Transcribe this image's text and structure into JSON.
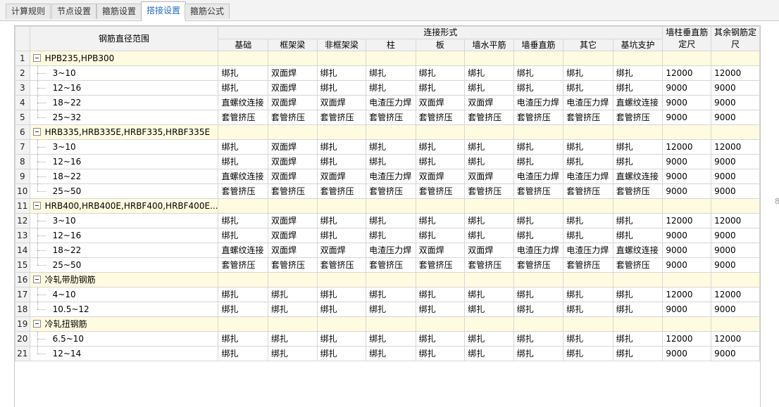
{
  "tabs": [
    {
      "label": "计算规则"
    },
    {
      "label": "节点设置"
    },
    {
      "label": "箍筋设置"
    },
    {
      "label": "搭接设置"
    },
    {
      "label": "箍筋公式"
    }
  ],
  "active_tab": 3,
  "header": {
    "range": "钢筋直径范围",
    "connection_form": "连接形式",
    "wall_col_len": "墙柱垂直筋定尺",
    "other_len": "其余钢筋定尺",
    "cols": [
      "基础",
      "框架梁",
      "非框架梁",
      "柱",
      "板",
      "墙水平筋",
      "墙垂直筋",
      "其它",
      "基坑支护"
    ]
  },
  "rows": [
    {
      "n": "1",
      "group": true,
      "label": "HPB235,HPB300"
    },
    {
      "n": "2",
      "range": "3~10",
      "cells": [
        "绑扎",
        "双面焊",
        "绑扎",
        "绑扎",
        "绑扎",
        "绑扎",
        "绑扎",
        "绑扎",
        "绑扎",
        "12000",
        "12000"
      ]
    },
    {
      "n": "3",
      "range": "12~16",
      "cells": [
        "绑扎",
        "双面焊",
        "绑扎",
        "绑扎",
        "绑扎",
        "绑扎",
        "绑扎",
        "绑扎",
        "绑扎",
        "9000",
        "9000"
      ]
    },
    {
      "n": "4",
      "range": "18~22",
      "cells": [
        "直螺纹连接",
        "双面焊",
        "双面焊",
        "电渣压力焊",
        "双面焊",
        "双面焊",
        "电渣压力焊",
        "电渣压力焊",
        "直螺纹连接",
        "9000",
        "9000"
      ]
    },
    {
      "n": "5",
      "range": "25~32",
      "last": true,
      "cells": [
        "套管挤压",
        "套管挤压",
        "套管挤压",
        "套管挤压",
        "套管挤压",
        "套管挤压",
        "套管挤压",
        "套管挤压",
        "套管挤压",
        "9000",
        "9000"
      ]
    },
    {
      "n": "6",
      "group": true,
      "label": "HRB335,HRB335E,HRBF335,HRBF335E"
    },
    {
      "n": "7",
      "range": "3~10",
      "cells": [
        "绑扎",
        "双面焊",
        "绑扎",
        "绑扎",
        "绑扎",
        "绑扎",
        "绑扎",
        "绑扎",
        "绑扎",
        "12000",
        "12000"
      ]
    },
    {
      "n": "8",
      "range": "12~16",
      "cells": [
        "绑扎",
        "双面焊",
        "绑扎",
        "绑扎",
        "绑扎",
        "绑扎",
        "绑扎",
        "绑扎",
        "绑扎",
        "9000",
        "9000"
      ]
    },
    {
      "n": "9",
      "range": "18~22",
      "cells": [
        "直螺纹连接",
        "双面焊",
        "双面焊",
        "电渣压力焊",
        "双面焊",
        "双面焊",
        "电渣压力焊",
        "电渣压力焊",
        "直螺纹连接",
        "9000",
        "9000"
      ]
    },
    {
      "n": "10",
      "range": "25~50",
      "last": true,
      "cells": [
        "套管挤压",
        "套管挤压",
        "套管挤压",
        "套管挤压",
        "套管挤压",
        "套管挤压",
        "套管挤压",
        "套管挤压",
        "套管挤压",
        "9000",
        "9000"
      ]
    },
    {
      "n": "11",
      "group": true,
      "label": "HRB400,HRB400E,HRBF400,HRBF400E..."
    },
    {
      "n": "12",
      "range": "3~10",
      "cells": [
        "绑扎",
        "双面焊",
        "绑扎",
        "绑扎",
        "绑扎",
        "绑扎",
        "绑扎",
        "绑扎",
        "绑扎",
        "12000",
        "12000"
      ]
    },
    {
      "n": "13",
      "range": "12~16",
      "cells": [
        "绑扎",
        "双面焊",
        "绑扎",
        "绑扎",
        "绑扎",
        "绑扎",
        "绑扎",
        "绑扎",
        "绑扎",
        "9000",
        "9000"
      ]
    },
    {
      "n": "14",
      "range": "18~22",
      "cells": [
        "直螺纹连接",
        "双面焊",
        "双面焊",
        "电渣压力焊",
        "双面焊",
        "双面焊",
        "电渣压力焊",
        "电渣压力焊",
        "直螺纹连接",
        "9000",
        "9000"
      ]
    },
    {
      "n": "15",
      "range": "25~50",
      "last": true,
      "cells": [
        "套管挤压",
        "套管挤压",
        "套管挤压",
        "套管挤压",
        "套管挤压",
        "套管挤压",
        "套管挤压",
        "套管挤压",
        "套管挤压",
        "9000",
        "9000"
      ]
    },
    {
      "n": "16",
      "group": true,
      "label": "冷轧带肋钢筋"
    },
    {
      "n": "17",
      "range": "4~10",
      "cells": [
        "绑扎",
        "绑扎",
        "绑扎",
        "绑扎",
        "绑扎",
        "绑扎",
        "绑扎",
        "绑扎",
        "绑扎",
        "12000",
        "12000"
      ]
    },
    {
      "n": "18",
      "range": "10.5~12",
      "last": true,
      "cells": [
        "绑扎",
        "绑扎",
        "绑扎",
        "绑扎",
        "绑扎",
        "绑扎",
        "绑扎",
        "绑扎",
        "绑扎",
        "9000",
        "9000"
      ]
    },
    {
      "n": "19",
      "group": true,
      "label": "冷轧扭钢筋"
    },
    {
      "n": "20",
      "range": "6.5~10",
      "cells": [
        "绑扎",
        "绑扎",
        "绑扎",
        "绑扎",
        "绑扎",
        "绑扎",
        "绑扎",
        "绑扎",
        "绑扎",
        "12000",
        "12000"
      ]
    },
    {
      "n": "21",
      "range": "12~14",
      "last": true,
      "cells": [
        "绑扎",
        "绑扎",
        "绑扎",
        "绑扎",
        "绑扎",
        "绑扎",
        "绑扎",
        "绑扎",
        "绑扎",
        "9000",
        "9000"
      ]
    }
  ],
  "colors": {
    "active_tab_text": "#1e6fc2",
    "group_row_bg": "#fffbe0",
    "header_bg": "#f2f2f2"
  }
}
